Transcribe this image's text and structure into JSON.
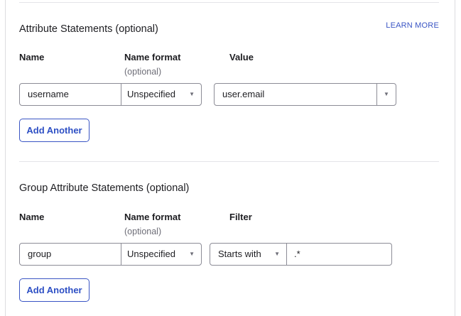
{
  "attr": {
    "title": "Attribute Statements (optional)",
    "learn_more": "LEARN MORE",
    "col_name": "Name",
    "col_format": "Name format",
    "col_format_sub": "(optional)",
    "col_value": "Value",
    "row": {
      "name": "username",
      "format": "Unspecified",
      "value": "user.email"
    },
    "add_label": "Add Another"
  },
  "group": {
    "title": "Group Attribute Statements (optional)",
    "col_name": "Name",
    "col_format": "Name format",
    "col_format_sub": "(optional)",
    "col_filter": "Filter",
    "row": {
      "name": "group",
      "format": "Unspecified",
      "filter_type": "Starts with",
      "filter_value": ".*"
    },
    "add_label": "Add Another"
  },
  "icons": {
    "caret": "▼"
  }
}
